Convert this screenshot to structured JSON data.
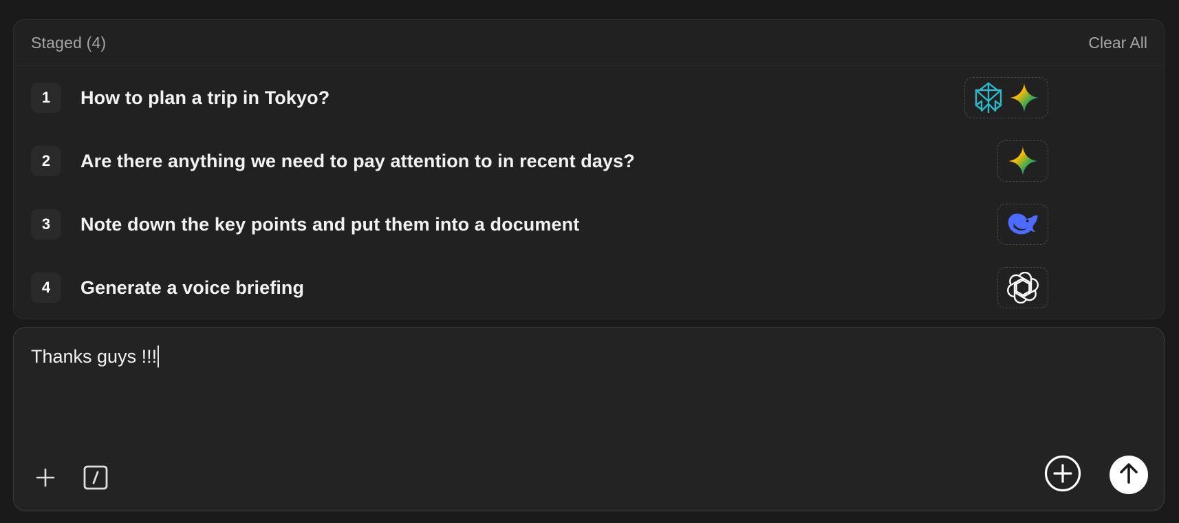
{
  "staged": {
    "title": "Staged (4)",
    "clear_label": "Clear All",
    "items": [
      {
        "num": "1",
        "text": "How to plan a trip in Tokyo?",
        "models": [
          "perplexity-icon",
          "gemini-icon"
        ]
      },
      {
        "num": "2",
        "text": "Are there anything we need to pay attention to in recent days?",
        "models": [
          "gemini-icon"
        ]
      },
      {
        "num": "3",
        "text": "Note down the key points and put them into a document",
        "models": [
          "deepseek-icon"
        ]
      },
      {
        "num": "4",
        "text": "Generate a voice briefing",
        "models": [
          "openai-icon"
        ]
      }
    ]
  },
  "composer": {
    "text": "Thanks guys !!!",
    "left_tools": [
      "plus-icon",
      "slash-command-icon"
    ],
    "right_tools": [
      "add-circle-icon",
      "send-arrow-icon"
    ]
  },
  "colors": {
    "background": "#1a1a1a",
    "panel": "#212121",
    "composer": "#232323",
    "muted_text": "#a6a6a6",
    "perplexity": "#2fb8c9",
    "deepseek": "#4d6bfe"
  }
}
